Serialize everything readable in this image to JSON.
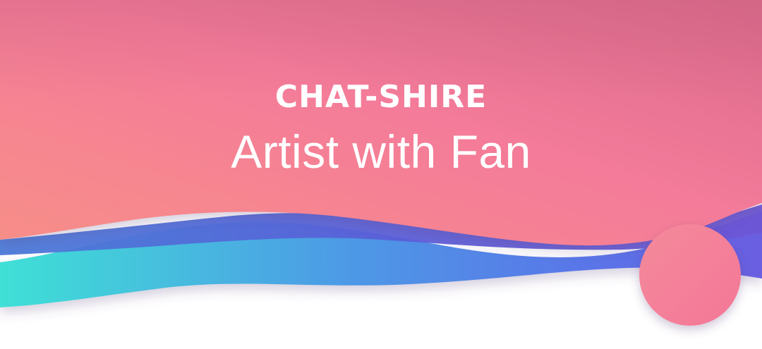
{
  "banner": {
    "brand": "CHAT-SHIRE",
    "tagline": "Artist with Fan"
  },
  "colors": {
    "pink_top": "#d96e86",
    "pink_mid": "#f27a9c",
    "coral": "#f68d8e",
    "wave_blue": "#5b6ee6",
    "wave_teal": "#3ee0d8",
    "wave_purple": "#6a5ad8"
  }
}
